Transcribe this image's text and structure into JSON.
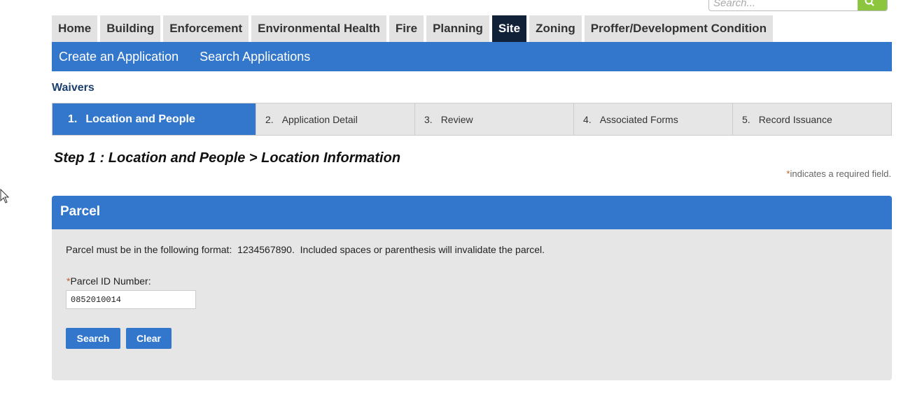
{
  "global_search": {
    "placeholder": "Search..."
  },
  "top_tabs": [
    {
      "label": "Home"
    },
    {
      "label": "Building"
    },
    {
      "label": "Enforcement"
    },
    {
      "label": "Environmental Health"
    },
    {
      "label": "Fire"
    },
    {
      "label": "Planning"
    },
    {
      "label": "Site",
      "active": true
    },
    {
      "label": "Zoning"
    },
    {
      "label": "Proffer/Development Condition"
    }
  ],
  "sub_nav": {
    "create": "Create an Application",
    "search": "Search Applications"
  },
  "module_title": "Waivers",
  "steps": [
    {
      "num": "1.",
      "label": "Location and People",
      "active": true
    },
    {
      "num": "2.",
      "label": "Application Detail"
    },
    {
      "num": "3.",
      "label": "Review"
    },
    {
      "num": "4.",
      "label": "Associated Forms"
    },
    {
      "num": "5.",
      "label": "Record Issuance"
    }
  ],
  "step_heading": "Step 1 : Location and People > Location Information",
  "required_note": {
    "asterisk": "*",
    "text": "indicates a required field."
  },
  "parcel_panel": {
    "title": "Parcel",
    "instructions": "Parcel must be in the following format:  1234567890.  Included spaces or parenthesis will invalidate the parcel.",
    "field_label": "Parcel ID Number:",
    "field_required": "*",
    "field_value": "0852010014",
    "search_button": "Search",
    "clear_button": "Clear"
  },
  "colors": {
    "accent_blue": "#3277cc",
    "active_tab": "#112138",
    "search_green": "#8cc63f",
    "panel_bg": "#e6e6e6"
  }
}
